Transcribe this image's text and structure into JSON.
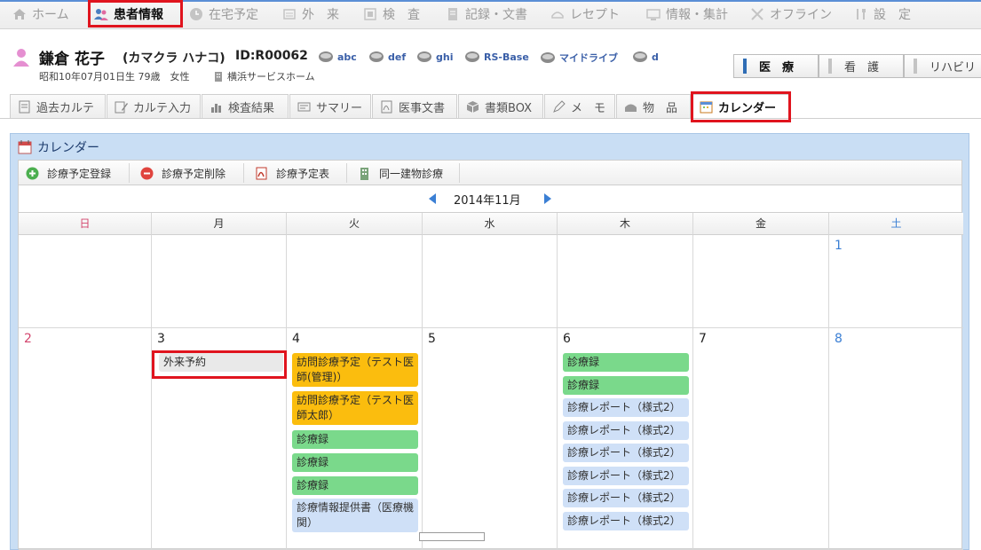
{
  "topnav": {
    "items": [
      {
        "label": "ホーム",
        "icon": "home-icon"
      },
      {
        "label": "患者情報",
        "icon": "patients-icon"
      },
      {
        "label": "在宅予定",
        "icon": "clock-icon"
      },
      {
        "label": "外　来",
        "icon": "outpatient-icon"
      },
      {
        "label": "検　査",
        "icon": "test-icon"
      },
      {
        "label": "記録・文書",
        "icon": "records-icon"
      },
      {
        "label": "レセプト",
        "icon": "receipt-icon"
      },
      {
        "label": "情報・集計",
        "icon": "monitor-icon"
      },
      {
        "label": "オフライン",
        "icon": "offline-icon"
      },
      {
        "label": "設　定",
        "icon": "settings-icon"
      }
    ]
  },
  "patient": {
    "name": "鎌倉 花子",
    "kana": "(カマクラ ハナコ)",
    "id": "ID:R00062",
    "birth": "昭和10年07月01日生 79歳　女性",
    "facility": "横浜サービスホーム",
    "tags": [
      "abc",
      "def",
      "ghi",
      "RS-Base",
      "マイドライブ",
      "d"
    ]
  },
  "dept": [
    "医　療",
    "看　護",
    "リハビリ"
  ],
  "subtabs": [
    "過去カルテ",
    "カルテ入力",
    "検査結果",
    "サマリー",
    "医事文書",
    "書類BOX",
    "メ　モ",
    "物　品",
    "カレンダー"
  ],
  "calendar": {
    "title": "カレンダー",
    "toolbar": [
      "診療予定登録",
      "診療予定削除",
      "診療予定表",
      "同一建物診療"
    ],
    "month": "2014年11月",
    "weekdays": [
      "日",
      "月",
      "火",
      "水",
      "木",
      "金",
      "土"
    ],
    "week1": [
      "",
      "",
      "",
      "",
      "",
      "",
      "1"
    ],
    "week2": [
      "2",
      "3",
      "4",
      "5",
      "6",
      "7",
      "8"
    ],
    "events": {
      "mon": [
        "外来予約"
      ],
      "tue": [
        "訪問診療予定（テスト医師(管理)）",
        "訪問診療予定（テスト医師太郎）",
        "診療録",
        "診療録",
        "診療録",
        "診療情報提供書（医療機関）"
      ],
      "thu": [
        "診療録",
        "診療録",
        "診療レポート（様式2）",
        "診療レポート（様式2）",
        "診療レポート（様式2）",
        "診療レポート（様式2）",
        "診療レポート（様式2）",
        "診療レポート（様式2）"
      ]
    }
  },
  "colors": {
    "accent": "#2f6db5",
    "highlight": "#e0141e",
    "orange": "#fbbd0e",
    "green": "#7ad98b",
    "blue": "#cfe0f7"
  }
}
